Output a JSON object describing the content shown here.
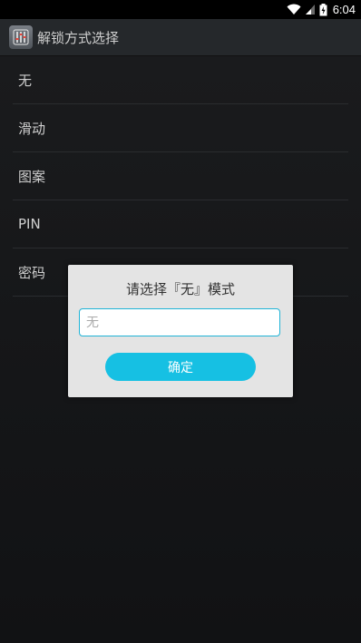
{
  "status_bar": {
    "time": "6:04",
    "icons": [
      "wifi-icon",
      "signal-icon",
      "battery-charging-icon"
    ]
  },
  "action_bar": {
    "title": "解锁方式选择",
    "icon": "app-sliders-icon"
  },
  "list": {
    "items": [
      {
        "label": "无"
      },
      {
        "label": "滑动"
      },
      {
        "label": "图案"
      },
      {
        "label": "PIN"
      },
      {
        "label": "密码"
      }
    ]
  },
  "dialog": {
    "title": "请选择『无』模式",
    "input_placeholder": "无",
    "input_value": "",
    "confirm_label": "确定"
  },
  "colors": {
    "accent": "#16c0e3",
    "dialog_bg": "#e4e4e4",
    "background": "#151618"
  }
}
